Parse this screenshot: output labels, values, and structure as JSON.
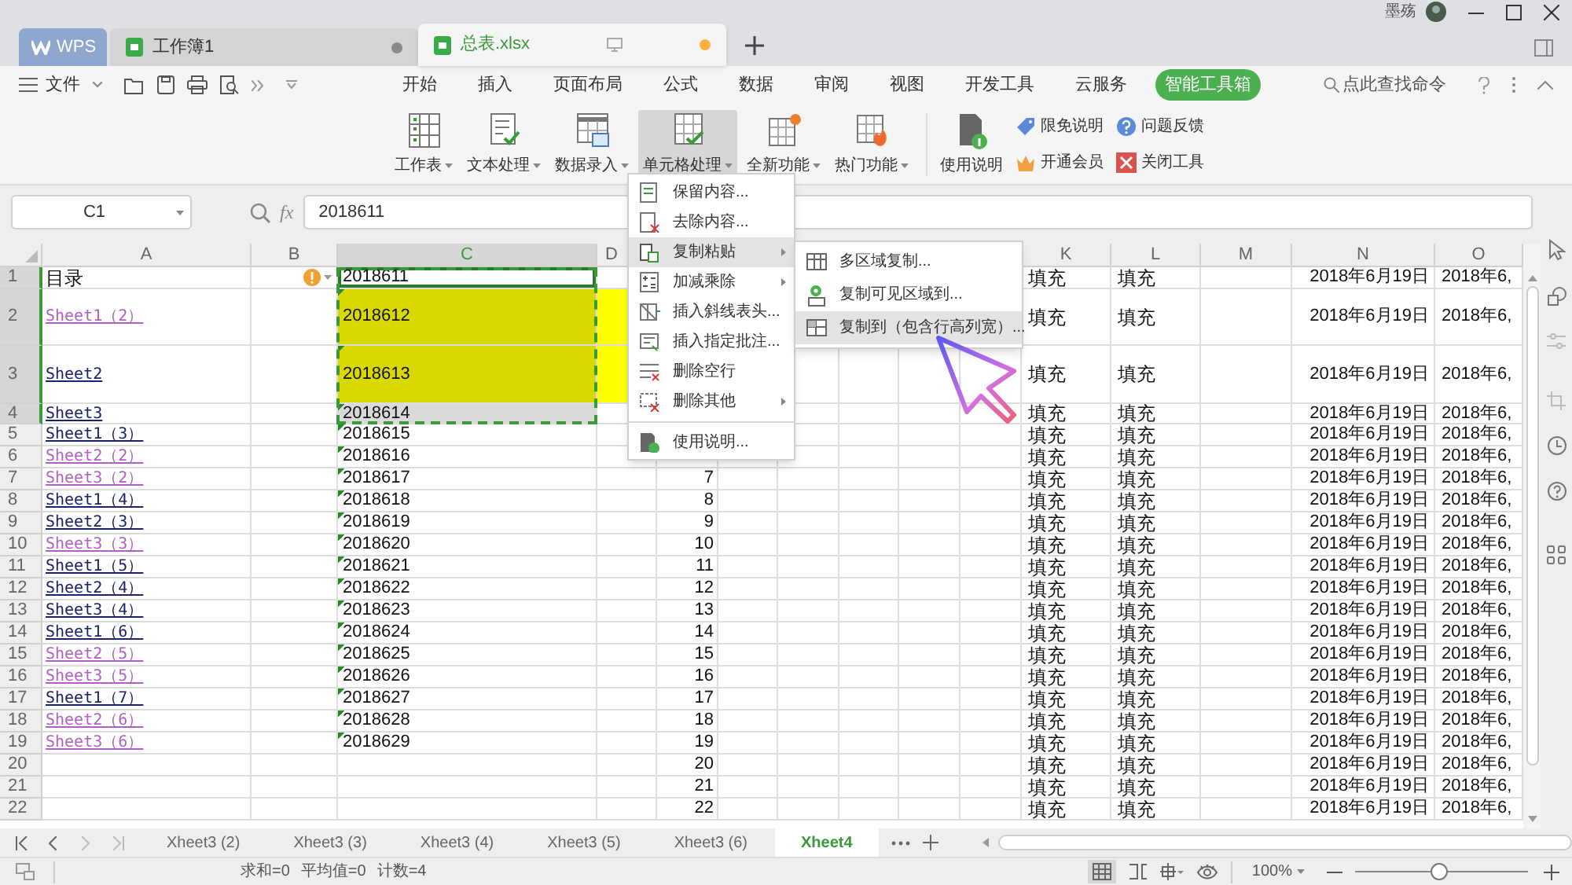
{
  "title_bar": {
    "tabs": [
      {
        "label": "WPS",
        "kind": "app",
        "selected": false
      },
      {
        "label": "工作簿1",
        "kind": "sheet",
        "selected": false,
        "modified": false
      },
      {
        "label": "总表.xlsx",
        "kind": "sheet",
        "selected": true,
        "modified": true
      }
    ],
    "user": "墨殇"
  },
  "menu": {
    "file": "文件",
    "tabs": [
      {
        "label": "开始",
        "selected": false
      },
      {
        "label": "插入",
        "selected": false
      },
      {
        "label": "页面布局",
        "selected": false
      },
      {
        "label": "公式",
        "selected": false
      },
      {
        "label": "数据",
        "selected": false
      },
      {
        "label": "审阅",
        "selected": false
      },
      {
        "label": "视图",
        "selected": false
      },
      {
        "label": "开发工具",
        "selected": false
      },
      {
        "label": "云服务",
        "selected": false
      },
      {
        "label": "智能工具箱",
        "selected": true
      }
    ],
    "search": {
      "placeholder": "点此查找命令"
    }
  },
  "ribbon": {
    "buttons": [
      {
        "label": "工作表",
        "dropdown": true,
        "pressed": false
      },
      {
        "label": "文本处理",
        "dropdown": true,
        "pressed": false
      },
      {
        "label": "数据录入",
        "dropdown": true,
        "pressed": false
      },
      {
        "label": "单元格处理",
        "dropdown": true,
        "pressed": true
      },
      {
        "label": "全新功能",
        "dropdown": true,
        "pressed": false
      },
      {
        "label": "热门功能",
        "dropdown": true,
        "pressed": false
      },
      {
        "label": "使用说明",
        "dropdown": false,
        "pressed": false
      }
    ],
    "links": [
      {
        "label": "限免说明"
      },
      {
        "label": "问题反馈"
      },
      {
        "label": "开通会员"
      },
      {
        "label": "关闭工具"
      }
    ]
  },
  "formula_bar": {
    "name_box": "C1",
    "function_label": "fx",
    "value": "2018611"
  },
  "columns": [
    {
      "label": "A",
      "selected": false
    },
    {
      "label": "B",
      "selected": false
    },
    {
      "label": "C",
      "selected": true
    },
    {
      "label": "D",
      "selected": false
    },
    {
      "label": "K",
      "selected": false
    },
    {
      "label": "L",
      "selected": false
    },
    {
      "label": "M",
      "selected": false
    },
    {
      "label": "N",
      "selected": false
    },
    {
      "label": "O",
      "selected": false
    }
  ],
  "rows": [
    {
      "number": "1",
      "selected": true,
      "smart_tag": true,
      "a": {
        "text": "目录",
        "kind": "title"
      },
      "c": {
        "text": "2018611",
        "active": true,
        "flag": false
      },
      "k": "填充",
      "l": "填充",
      "n": "2018年6月19日",
      "o": "2018年6,"
    },
    {
      "number": "2",
      "selected": true,
      "highlight": true,
      "a": {
        "text": "Sheet1（2）",
        "kind": "link",
        "visited": true
      },
      "c": {
        "text": "2018612",
        "active": false,
        "flag": true
      },
      "k": "填充",
      "l": "填充",
      "n": "2018年6月19日",
      "o": "2018年6,"
    },
    {
      "number": "3",
      "selected": true,
      "highlight": true,
      "a": {
        "text": "Sheet2",
        "kind": "link",
        "visited": false
      },
      "c": {
        "text": "2018613",
        "active": false,
        "flag": true
      },
      "k": "填充",
      "l": "填充",
      "n": "2018年6月19日",
      "o": "2018年6,"
    },
    {
      "number": "4",
      "selected": true,
      "a": {
        "text": "Sheet3",
        "kind": "link",
        "visited": false
      },
      "c": {
        "text": "2018614",
        "active": false,
        "flag": true
      },
      "k": "填充",
      "l": "填充",
      "n": "2018年6月19日",
      "o": "2018年6,"
    },
    {
      "number": "5",
      "selected": false,
      "a": {
        "text": "Sheet1（3）",
        "kind": "link",
        "visited": false
      },
      "c": {
        "text": "2018615",
        "active": false,
        "flag": true
      },
      "k": "填充",
      "l": "填充",
      "n": "2018年6月19日",
      "o": "2018年6,"
    },
    {
      "number": "6",
      "selected": false,
      "a": {
        "text": "Sheet2（2）",
        "kind": "link",
        "visited": true
      },
      "c": {
        "text": "2018616",
        "active": false,
        "flag": true
      },
      "k": "填充",
      "l": "填充",
      "n": "2018年6月19日",
      "o": "2018年6,"
    },
    {
      "number": "7",
      "selected": false,
      "a": {
        "text": "Sheet3（2）",
        "kind": "link",
        "visited": true
      },
      "c": {
        "text": "2018617",
        "active": false,
        "flag": true
      },
      "e": "7",
      "k": "填充",
      "l": "填充",
      "n": "2018年6月19日",
      "o": "2018年6,"
    },
    {
      "number": "8",
      "selected": false,
      "a": {
        "text": "Sheet1（4）",
        "kind": "link",
        "visited": false
      },
      "c": {
        "text": "2018618",
        "active": false,
        "flag": true
      },
      "e": "8",
      "k": "填充",
      "l": "填充",
      "n": "2018年6月19日",
      "o": "2018年6,"
    },
    {
      "number": "9",
      "selected": false,
      "a": {
        "text": "Sheet2（3）",
        "kind": "link",
        "visited": false
      },
      "c": {
        "text": "2018619",
        "active": false,
        "flag": true
      },
      "e": "9",
      "k": "填充",
      "l": "填充",
      "n": "2018年6月19日",
      "o": "2018年6,"
    },
    {
      "number": "10",
      "selected": false,
      "a": {
        "text": "Sheet3（3）",
        "kind": "link",
        "visited": true
      },
      "c": {
        "text": "2018620",
        "active": false,
        "flag": true
      },
      "e": "10",
      "k": "填充",
      "l": "填充",
      "n": "2018年6月19日",
      "o": "2018年6,"
    },
    {
      "number": "11",
      "selected": false,
      "a": {
        "text": "Sheet1（5）",
        "kind": "link",
        "visited": false
      },
      "c": {
        "text": "2018621",
        "active": false,
        "flag": true
      },
      "e": "11",
      "k": "填充",
      "l": "填充",
      "n": "2018年6月19日",
      "o": "2018年6,"
    },
    {
      "number": "12",
      "selected": false,
      "a": {
        "text": "Sheet2（4）",
        "kind": "link",
        "visited": false
      },
      "c": {
        "text": "2018622",
        "active": false,
        "flag": true
      },
      "e": "12",
      "k": "填充",
      "l": "填充",
      "n": "2018年6月19日",
      "o": "2018年6,"
    },
    {
      "number": "13",
      "selected": false,
      "a": {
        "text": "Sheet3（4）",
        "kind": "link",
        "visited": false
      },
      "c": {
        "text": "2018623",
        "active": false,
        "flag": true
      },
      "e": "13",
      "k": "填充",
      "l": "填充",
      "n": "2018年6月19日",
      "o": "2018年6,"
    },
    {
      "number": "14",
      "selected": false,
      "a": {
        "text": "Sheet1（6）",
        "kind": "link",
        "visited": false
      },
      "c": {
        "text": "2018624",
        "active": false,
        "flag": true
      },
      "e": "14",
      "k": "填充",
      "l": "填充",
      "n": "2018年6月19日",
      "o": "2018年6,"
    },
    {
      "number": "15",
      "selected": false,
      "a": {
        "text": "Sheet2（5）",
        "kind": "link",
        "visited": true
      },
      "c": {
        "text": "2018625",
        "active": false,
        "flag": true
      },
      "e": "15",
      "k": "填充",
      "l": "填充",
      "n": "2018年6月19日",
      "o": "2018年6,"
    },
    {
      "number": "16",
      "selected": false,
      "a": {
        "text": "Sheet3（5）",
        "kind": "link",
        "visited": true
      },
      "c": {
        "text": "2018626",
        "active": false,
        "flag": true
      },
      "e": "16",
      "k": "填充",
      "l": "填充",
      "n": "2018年6月19日",
      "o": "2018年6,"
    },
    {
      "number": "17",
      "selected": false,
      "a": {
        "text": "Sheet1（7）",
        "kind": "link",
        "visited": false
      },
      "c": {
        "text": "2018627",
        "active": false,
        "flag": true
      },
      "e": "17",
      "k": "填充",
      "l": "填充",
      "n": "2018年6月19日",
      "o": "2018年6,"
    },
    {
      "number": "18",
      "selected": false,
      "a": {
        "text": "Sheet2（6）",
        "kind": "link",
        "visited": true
      },
      "c": {
        "text": "2018628",
        "active": false,
        "flag": true
      },
      "e": "18",
      "k": "填充",
      "l": "填充",
      "n": "2018年6月19日",
      "o": "2018年6,"
    },
    {
      "number": "19",
      "selected": false,
      "a": {
        "text": "Sheet3（6）",
        "kind": "link",
        "visited": true
      },
      "c": {
        "text": "2018629",
        "active": false,
        "flag": true
      },
      "e": "19",
      "k": "填充",
      "l": "填充",
      "n": "2018年6月19日",
      "o": "2018年6,"
    },
    {
      "number": "20",
      "selected": false,
      "e": "20",
      "k": "填充",
      "l": "填充",
      "n": "2018年6月19日",
      "o": "2018年6,"
    },
    {
      "number": "21",
      "selected": false,
      "e": "21",
      "k": "填充",
      "l": "填充",
      "n": "2018年6月19日",
      "o": "2018年6,"
    },
    {
      "number": "22",
      "selected": false,
      "e": "22",
      "k": "填充",
      "l": "填充",
      "n": "2018年6月19日",
      "o": "2018年6,"
    }
  ],
  "context_menu": {
    "items": [
      {
        "label": "保留内容...",
        "submenu": false,
        "hovered": false
      },
      {
        "label": "去除内容...",
        "submenu": false,
        "hovered": false
      },
      {
        "label": "复制粘贴",
        "submenu": true,
        "hovered": true
      },
      {
        "label": "加减乘除",
        "submenu": true,
        "hovered": false
      },
      {
        "label": "插入斜线表头...",
        "submenu": false,
        "hovered": false
      },
      {
        "label": "插入指定批注...",
        "submenu": false,
        "hovered": false
      },
      {
        "label": "删除空行",
        "submenu": false,
        "hovered": false
      },
      {
        "label": "删除其他",
        "submenu": true,
        "hovered": false
      },
      {
        "label": "使用说明...",
        "submenu": false,
        "hovered": false,
        "separated": true
      }
    ]
  },
  "submenu": {
    "items": [
      {
        "label": "多区域复制...",
        "hovered": false
      },
      {
        "label": "复制可见区域到...",
        "hovered": false
      },
      {
        "label": "复制到（包含行高列宽）...",
        "hovered": true
      }
    ]
  },
  "sheet_tabs": [
    {
      "label": "Xheet3 (2)",
      "selected": false
    },
    {
      "label": "Xheet3 (3)",
      "selected": false
    },
    {
      "label": "Xheet3 (4)",
      "selected": false
    },
    {
      "label": "Xheet3 (5)",
      "selected": false
    },
    {
      "label": "Xheet3 (6)",
      "selected": false
    },
    {
      "label": "Xheet4",
      "selected": true
    }
  ],
  "status_bar": {
    "stats": [
      "求和=0",
      "平均值=0",
      "计数=4"
    ],
    "zoom": "100%",
    "zoom_slider": {
      "level": 0.48
    }
  }
}
